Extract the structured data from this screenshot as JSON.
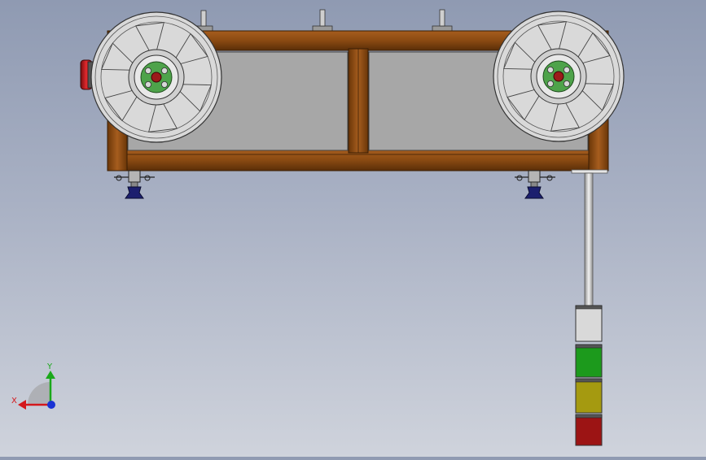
{
  "viewport": {
    "colors": {
      "background_top": "#8f9ab2",
      "background_bottom": "#cfd3dc",
      "frame_wood": "#8a4a12",
      "frame_wood_dark": "#5a2e08",
      "panel_gray": "#a7a7a7",
      "reel_gray": "#d9d9d9",
      "hub_green": "#4ea34a",
      "hub_center_red": "#9c1a1a",
      "foot_blue": "#1c1f6e",
      "knob_red": "#c2181c"
    }
  },
  "signal_tower": {
    "segments": [
      "white",
      "green",
      "yellow",
      "red"
    ],
    "colors": {
      "white": "#d9d9d9",
      "green": "#1c9a1c",
      "yellow": "#a59a10",
      "red": "#9c1414"
    }
  },
  "triad": {
    "x_label": "X",
    "y_label": "Y",
    "x_color": "#d4181c",
    "y_color": "#1aa81a",
    "z_color": "#1a33d4"
  }
}
